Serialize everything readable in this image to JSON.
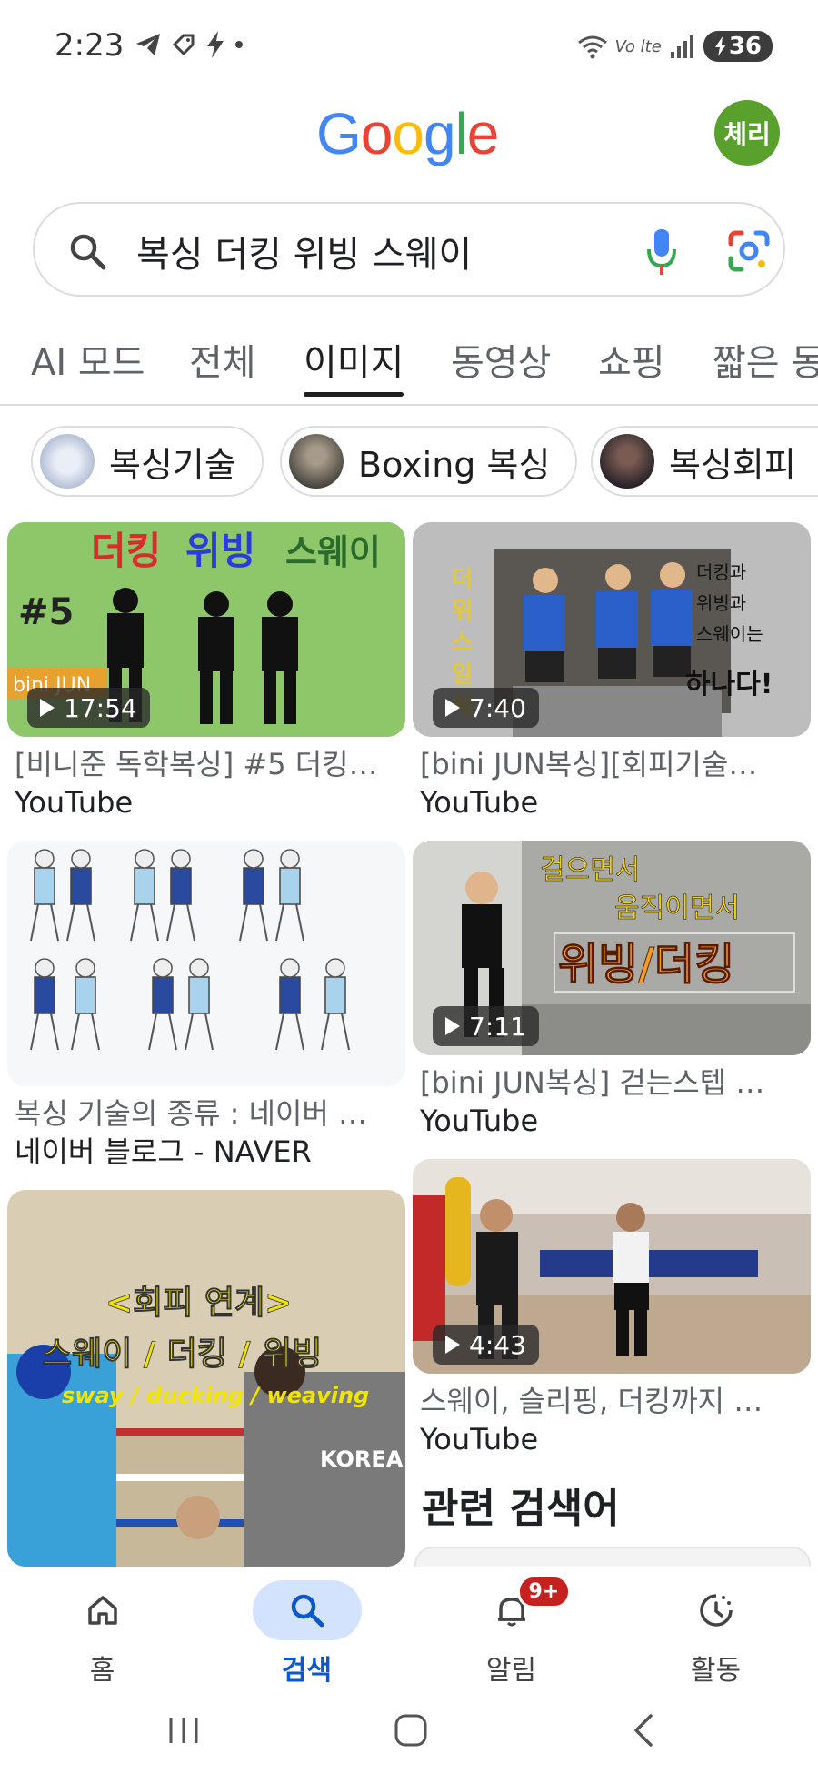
{
  "status_bar": {
    "time": "2:23",
    "network_label": "Vo lte",
    "battery": "36"
  },
  "header": {
    "logo_letters": [
      {
        "char": "G",
        "color": "#4285F4"
      },
      {
        "char": "o",
        "color": "#EA4335"
      },
      {
        "char": "o",
        "color": "#FBBC05"
      },
      {
        "char": "g",
        "color": "#4285F4"
      },
      {
        "char": "l",
        "color": "#34A853"
      },
      {
        "char": "e",
        "color": "#EA4335"
      }
    ],
    "avatar_label": "체리",
    "avatar_color": "#5aa02c"
  },
  "search": {
    "query": "복싱 더킹 위빙 스웨이",
    "icons": [
      "search-icon",
      "mic-icon",
      "google-lens-icon"
    ]
  },
  "tabs": [
    {
      "label": "AI 모드",
      "active": false
    },
    {
      "label": "전체",
      "active": false
    },
    {
      "label": "이미지",
      "active": true
    },
    {
      "label": "동영상",
      "active": false
    },
    {
      "label": "쇼핑",
      "active": false
    },
    {
      "label": "짧은 동",
      "active": false
    }
  ],
  "chips": [
    {
      "label": "복싱기술"
    },
    {
      "label": "Boxing 복싱"
    },
    {
      "label": "복싱회피"
    }
  ],
  "results": [
    {
      "title": "[비니준 독학복싱] #5 더킹…",
      "source": "YouTube",
      "duration": "17:54",
      "overlay_text": [
        "더킹",
        "위빙",
        "스웨이",
        "#5",
        "bini JUN"
      ]
    },
    {
      "title": "[bini JUN복싱][회피기술…",
      "source": "YouTube",
      "duration": "7:40",
      "overlay_text": [
        "더 위 스 일 체",
        "더킹과",
        "위빙과",
        "스웨이는",
        "하나다!"
      ]
    },
    {
      "title": "복싱 기술의 종류 : 네이버 …",
      "source": "네이버 블로그 - NAVER",
      "duration": null
    },
    {
      "title": "[bini JUN복싱] 걷는스텝 …",
      "source": "YouTube",
      "duration": "7:11",
      "overlay_text": [
        "걸으면서",
        "움직이면서",
        "위빙/더킹"
      ]
    },
    {
      "title": "",
      "source": "",
      "duration": null,
      "overlay_text": [
        "<회피 연계>",
        "스웨이 / 더킹 / 위빙",
        "sway / ducking / weaving",
        "KOREA"
      ]
    },
    {
      "title": "스웨이, 슬리핑, 더킹까지 …",
      "source": "YouTube",
      "duration": "4:43"
    }
  ],
  "related_heading": "관련 검색어",
  "bottom_nav": [
    {
      "label": "홈",
      "icon": "home-icon",
      "active": false
    },
    {
      "label": "검색",
      "icon": "search-icon",
      "active": true
    },
    {
      "label": "알림",
      "icon": "bell-icon",
      "active": false,
      "badge": "9+"
    },
    {
      "label": "활동",
      "icon": "activity-icon",
      "active": false
    }
  ]
}
